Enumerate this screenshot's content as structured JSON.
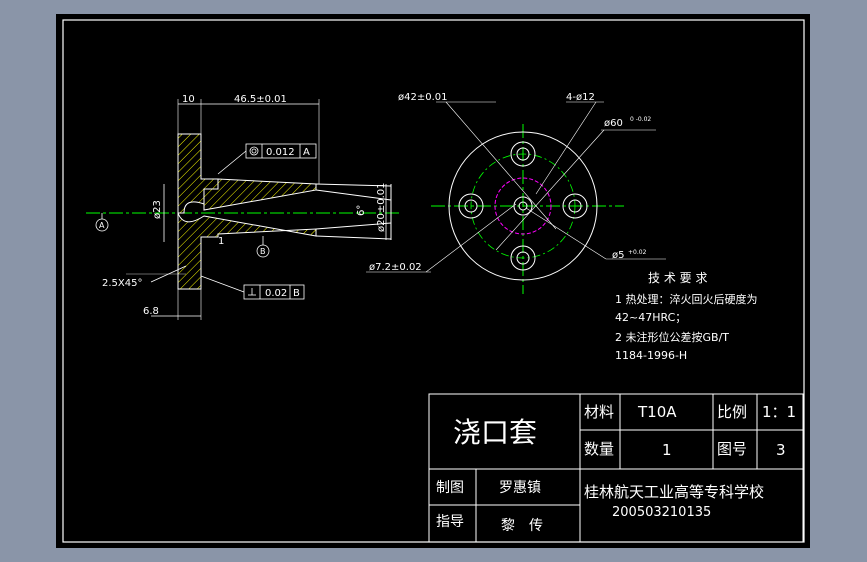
{
  "dims": {
    "d10": "10",
    "d46": "46.5±0.01",
    "tol1": "0.012",
    "tol1_ref": "A",
    "d23": "ø23",
    "d20": "ø20±0.01",
    "d6deg": "6°",
    "d1": "1",
    "chamfer": "2.5X45°",
    "tol2": "0.02",
    "tol2_ref": "B",
    "d68": "6.8",
    "datum_a": "A",
    "datum_b": "B",
    "d42": "ø42±0.01",
    "holes": "4-ø12",
    "d60": "ø60",
    "d60_tol": "0\n-0.02",
    "d72": "ø7.2±0.02",
    "d5": "ø5",
    "d5_tol": "+0.02"
  },
  "notes": {
    "title": "技 术 要 求",
    "line1": "1 热处理：淬火回火后硬度为",
    "line2": "42~47HRC；",
    "line3": "2 未注形位公差按GB/T",
    "line4": "1184-1996-H"
  },
  "titleblock": {
    "part_name": "浇口套",
    "material_label": "材料",
    "material_value": "T10A",
    "scale_label": "比例",
    "scale_value": "1：1",
    "qty_label": "数量",
    "qty_value": "1",
    "drawing_no_label": "图号",
    "drawing_no_value": "3",
    "drawn_label": "制图",
    "drawn_value": "罗惠镇",
    "guide_label": "指导",
    "guide_value": "黎　传",
    "school": "桂林航天工业高等专科学校",
    "student_id": "200503210135"
  }
}
